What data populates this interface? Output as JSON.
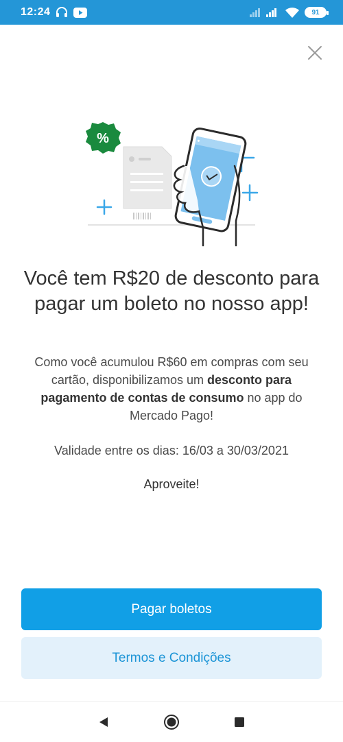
{
  "status_bar": {
    "time": "12:24",
    "battery": "91",
    "icons": [
      "headphones-icon",
      "youtube-icon",
      "signal-icon",
      "wifi-icon",
      "battery-icon"
    ]
  },
  "close_icon": "close-icon",
  "illustration": {
    "badge_symbol": "%",
    "icons": [
      "discount-badge-icon",
      "phone-check-icon",
      "boleto-document-icon",
      "plus-sparkle-icon"
    ]
  },
  "offer": {
    "title": "Você tem R$20 de desconto para pagar um boleto no nosso app!",
    "description_part1": "Como você acumulou R$60 em compras com seu cartão, disponibilizamos um ",
    "description_bold": "desconto para pagamento de contas de consumo",
    "description_part2": " no app do Mercado Pago!",
    "validity": "Validade entre os dias: 16/03 a 30/03/2021",
    "cta_text": "Aproveite!"
  },
  "buttons": {
    "primary_label": "Pagar boletos",
    "secondary_label": "Termos e Condições"
  },
  "navigation": {
    "icons": [
      "back-icon",
      "home-icon",
      "recents-icon"
    ]
  },
  "colors": {
    "status_bar": "#2496d7",
    "primary_button": "#119fe6",
    "secondary_button_bg": "#e3f1fb",
    "secondary_button_text": "#1b94d6",
    "badge_green": "#1a8a3e"
  }
}
